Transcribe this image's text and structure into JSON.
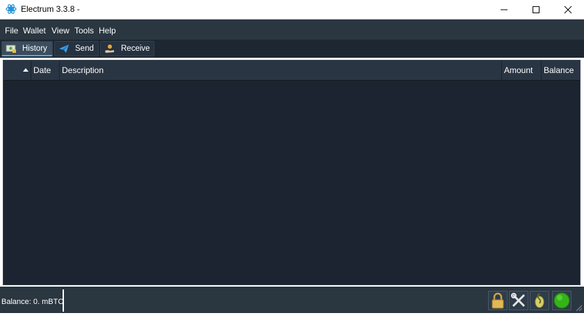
{
  "window": {
    "title": "Electrum 3.3.8  -",
    "app_icon": "electrum-logo-icon",
    "controls": [
      "minimize-icon",
      "maximize-icon",
      "close-icon"
    ]
  },
  "menu": {
    "items": [
      {
        "label": "File"
      },
      {
        "label": "Wallet"
      },
      {
        "label": "View"
      },
      {
        "label": "Tools"
      },
      {
        "label": "Help"
      }
    ]
  },
  "tabs": [
    {
      "label": "History",
      "icon": "history-tab-icon",
      "active": true
    },
    {
      "label": "Send",
      "icon": "send-tab-icon",
      "active": false
    },
    {
      "label": "Receive",
      "icon": "receive-tab-icon",
      "active": false
    }
  ],
  "history_table": {
    "sort_indicator": "ascending",
    "columns": [
      "",
      "Date",
      "Description",
      "Amount",
      "Balance"
    ],
    "rows": []
  },
  "status": {
    "balance": "Balance: 0. mBTC",
    "icons": [
      "lock-icon",
      "preferences-icon",
      "seed-icon",
      "network-status-icon"
    ]
  },
  "colors": {
    "menu_bg": "#2a3640",
    "panel_bg": "#1b2430",
    "header_bg": "#2a3543",
    "network_ok": "#35b31a"
  }
}
